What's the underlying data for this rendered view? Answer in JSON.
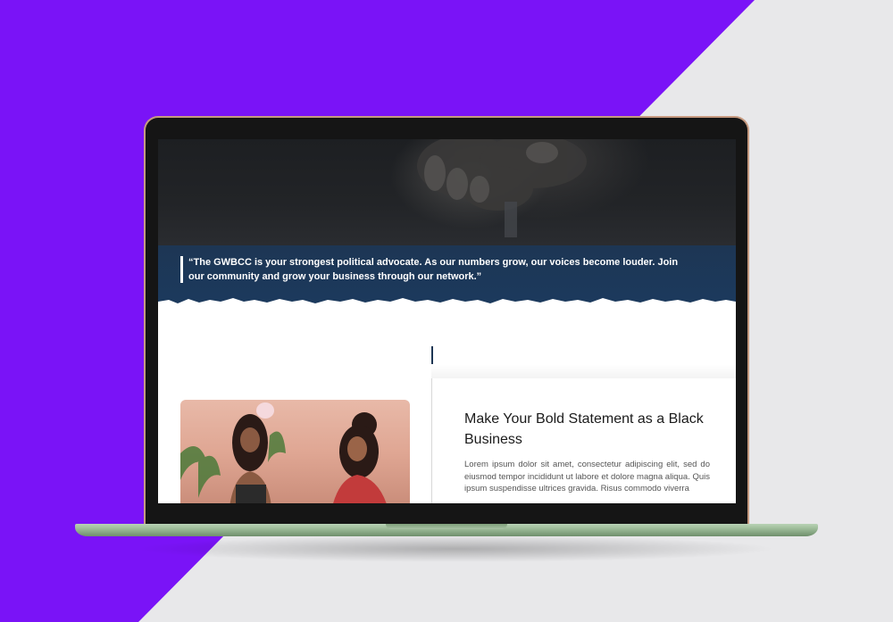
{
  "hero": {
    "quote": "“The GWBCC is your strongest political advocate. As our numbers grow, our voices become louder. Join our community and grow your business through our network.”"
  },
  "feature": {
    "title": "Make Your Bold Statement as a Black Business",
    "body": "Lorem ipsum dolor sit amet, consectetur adipiscing elit, sed do eiusmod tempor incididunt ut labore et dolore magna aliqua. Quis ipsum suspendisse ultrices gravida. Risus commodo viverra"
  },
  "colors": {
    "background_accent": "#7a13f7",
    "quote_band": "#1d3654",
    "laptop_base": "#9cbb98"
  }
}
